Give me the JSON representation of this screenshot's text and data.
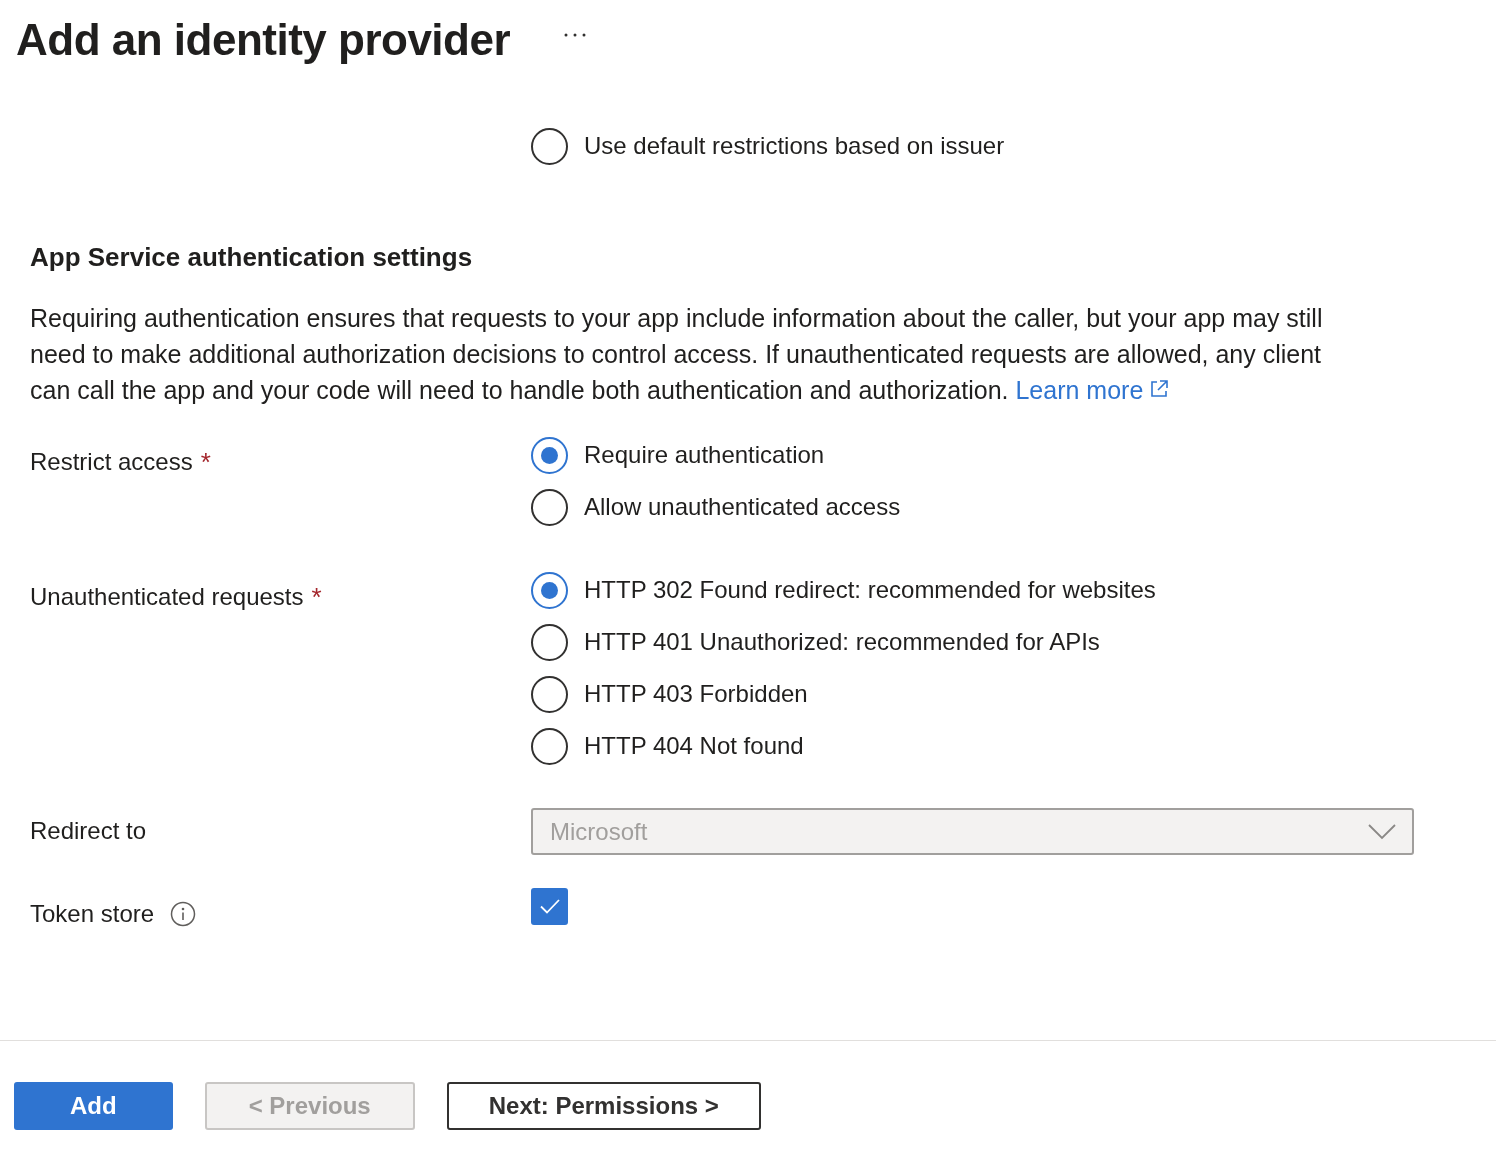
{
  "header": {
    "title": "Add an identity provider"
  },
  "issuer_restriction": {
    "options": [
      {
        "label": "Use default restrictions based on issuer",
        "selected": false
      }
    ]
  },
  "section": {
    "title": "App Service authentication settings",
    "description": "Requiring authentication ensures that requests to your app include information about the caller, but your app may still need to make additional authorization decisions to control access. If unauthenticated requests are allowed, any client can call the app and your code will need to handle both authentication and authorization.",
    "link": "Learn more"
  },
  "fields": [
    {
      "kind": "radio",
      "label": "Restrict access",
      "required_mark": "*",
      "options": [
        {
          "label": "Require authentication",
          "selected": true
        },
        {
          "label": "Allow unauthenticated access",
          "selected": false
        }
      ]
    },
    {
      "kind": "radio",
      "label": "Unauthenticated requests",
      "required_mark": "*",
      "options": [
        {
          "label": "HTTP 302 Found redirect: recommended for websites",
          "selected": true
        },
        {
          "label": "HTTP 401 Unauthorized: recommended for APIs",
          "selected": false
        },
        {
          "label": "HTTP 403 Forbidden",
          "selected": false
        },
        {
          "label": "HTTP 404 Not found",
          "selected": false
        }
      ]
    },
    {
      "kind": "dropdown",
      "label": "Redirect to",
      "value": "Microsoft",
      "disabled": true
    },
    {
      "kind": "checkbox",
      "label": "Token store",
      "info": true,
      "checked": true
    }
  ],
  "buttons": [
    {
      "label": "Add",
      "kind": "primary",
      "disabled": false
    },
    {
      "label": "< Previous",
      "kind": "default",
      "disabled": true
    },
    {
      "label": "Next: Permissions >",
      "kind": "default",
      "disabled": false
    }
  ]
}
